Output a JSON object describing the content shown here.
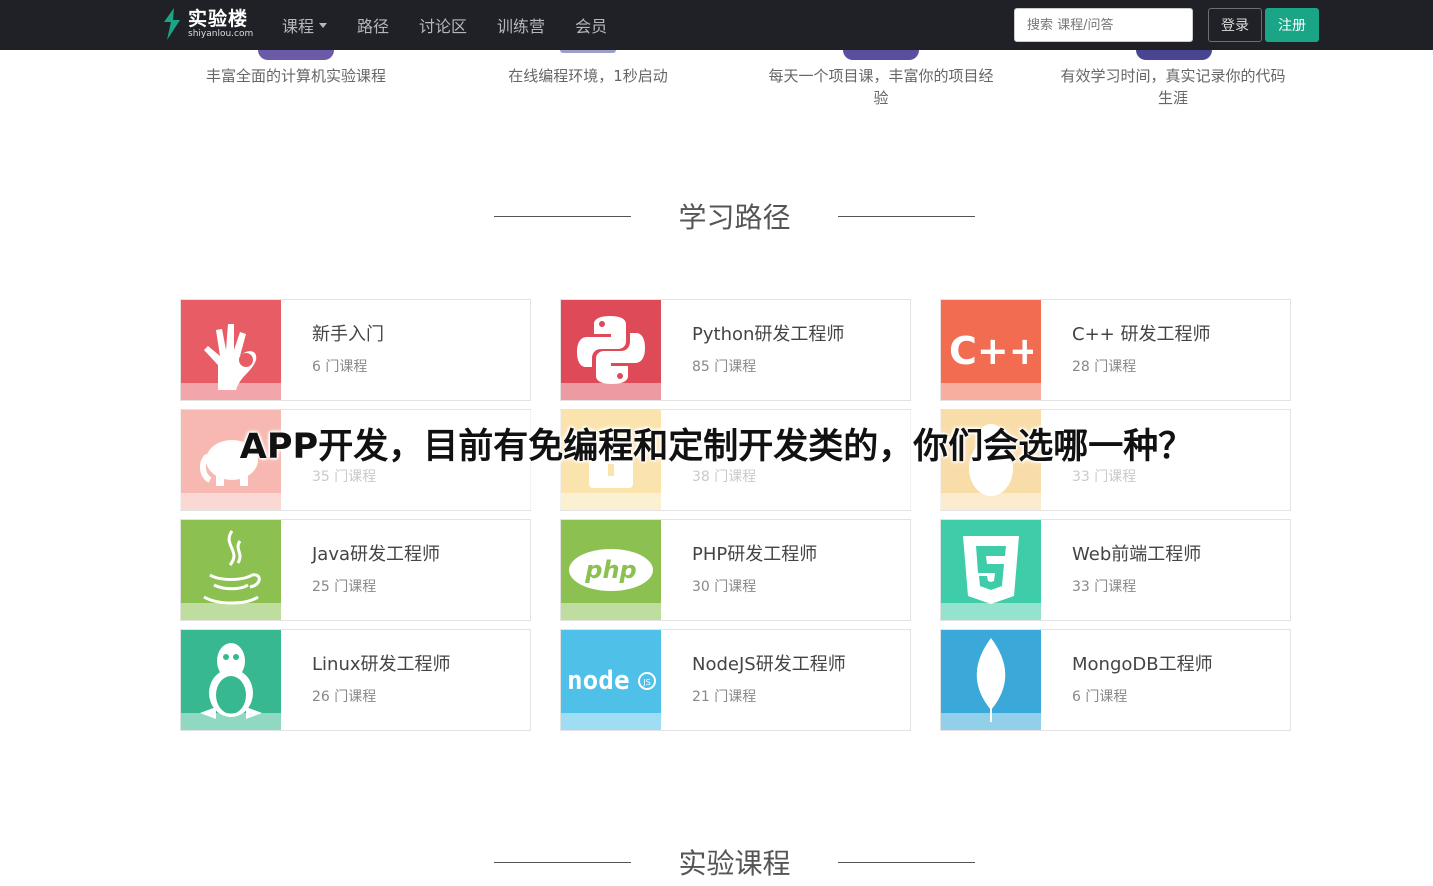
{
  "navbar": {
    "logo_cn": "实验楼",
    "logo_en": "shiyanlou.com",
    "links": [
      "课程",
      "路径",
      "讨论区",
      "训练营",
      "会员"
    ],
    "search_placeholder": "搜索 课程/问答",
    "login": "登录",
    "signup": "注册"
  },
  "features": [
    "丰富全面的计算机实验课程",
    "在线编程环境，1秒启动",
    "每天一个项目课，丰富你的项目经验",
    "有效学习时间，真实记录你的代码生涯"
  ],
  "sections": {
    "paths_title": "学习路径",
    "courses_title": "实验课程"
  },
  "paths": [
    {
      "title": "新手入门",
      "count": "6 门课程",
      "color": "#e85c66",
      "icon": "ok-hand-icon"
    },
    {
      "title": "Python研发工程师",
      "count": "85 门课程",
      "color": "#df4a58",
      "icon": "python-icon"
    },
    {
      "title": "C++ 研发工程师",
      "count": "28 门课程",
      "color": "#f26c51",
      "icon": "cpp-icon"
    },
    {
      "title": "",
      "count": "35 门课程",
      "color": "#ea6251",
      "icon": "elephant-icon"
    },
    {
      "title": "",
      "count": "38 门课程",
      "color": "#f5c24a",
      "icon": "lock-icon"
    },
    {
      "title": "",
      "count": "33 门课程",
      "color": "#f2b340",
      "icon": "penguin-icon"
    },
    {
      "title": "Java研发工程师",
      "count": "25 门课程",
      "color": "#8cc152",
      "icon": "java-icon"
    },
    {
      "title": "PHP研发工程师",
      "count": "30 门课程",
      "color": "#8cc152",
      "icon": "php-icon"
    },
    {
      "title": "Web前端工程师",
      "count": "33 门课程",
      "color": "#3fcca8",
      "icon": "html5-icon"
    },
    {
      "title": "Linux研发工程师",
      "count": "26 门课程",
      "color": "#37b891",
      "icon": "linux-icon"
    },
    {
      "title": "NodeJS研发工程师",
      "count": "21 门课程",
      "color": "#4fc1e9",
      "icon": "nodejs-icon"
    },
    {
      "title": "MongoDB工程师",
      "count": "6 门课程",
      "color": "#3aa8d8",
      "icon": "mongodb-icon"
    }
  ],
  "headline": "APP开发，目前有免编程和定制开发类的，你们会选哪一种？"
}
